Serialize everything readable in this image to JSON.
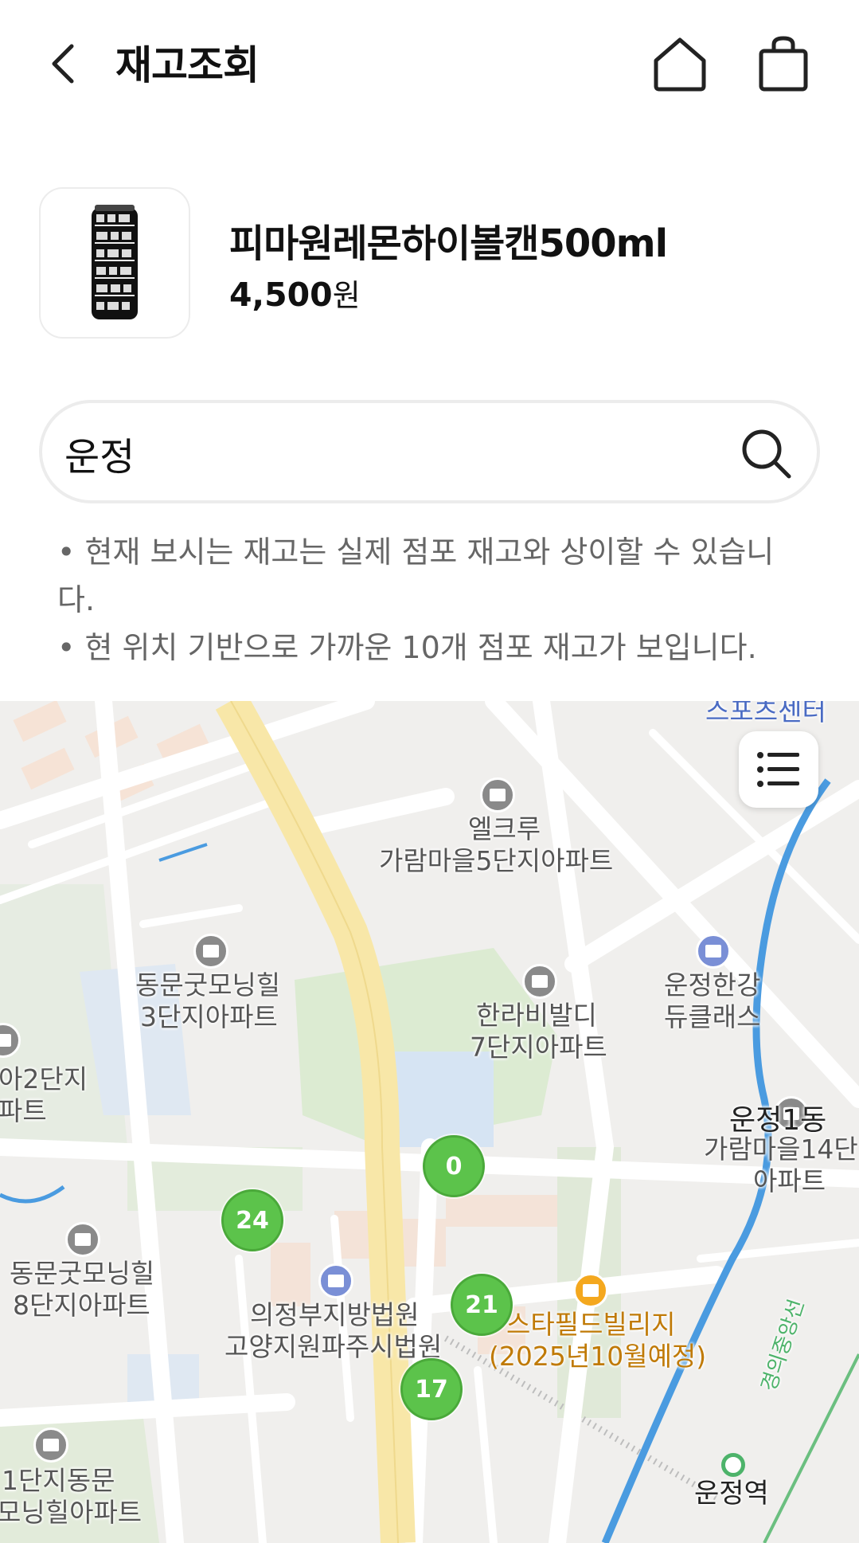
{
  "header": {
    "title": "재고조회",
    "back_icon": "chevron-left-icon",
    "home_icon": "home-icon",
    "bag_icon": "shopping-bag-icon"
  },
  "product": {
    "name": "피마원레몬하이볼캔500ml",
    "price": "4,500",
    "price_unit": "원"
  },
  "search": {
    "value": "운정",
    "icon": "search-icon"
  },
  "notices": [
    "• 현재 보시는 재고는 실제 점포 재고와 상이할 수 있습니다.",
    "• 현 위치 기반으로 가까운 10개 점포 재고가 보입니다."
  ],
  "map": {
    "list_icon": "list-icon",
    "labels": {
      "sports_center": "스포츠센터",
      "elcru_1": "엘크루",
      "elcru_2": "가람마을5단지아파트",
      "dongmun3_1": "동문굿모닝힐",
      "dongmun3_2": "3단지아파트",
      "hanra_1": "한라비발디",
      "hanra_2": "7단지아파트",
      "unjeong_hangang_1": "운정한강",
      "unjeong_hangang_2": "듀클래스",
      "edge_left_1": "아2단지",
      "edge_left_2": "파트",
      "unjeong_dong": "운정1동",
      "garam14_1": "가람마을14단",
      "garam14_2": "아파트",
      "dongmun8_1": "동문굿모닝힐",
      "dongmun8_2": "8단지아파트",
      "court_1": "의정부지방법원",
      "court_2": "고양지원파주시법원",
      "starfield_1": "스타필드빌리지",
      "starfield_2": "(2025년10월예정)",
      "gyeongui": "경의중앙선",
      "dongmun1_1": "1단지동문",
      "dongmun1_2": "모닝힐아파트",
      "station": "운정역"
    },
    "markers": [
      "0",
      "24",
      "21",
      "17"
    ]
  },
  "colors": {
    "marker_green": "#5cc34b",
    "main_road": "#f8e7a8",
    "water": "#4a9be0",
    "park": "#dcebd2"
  }
}
